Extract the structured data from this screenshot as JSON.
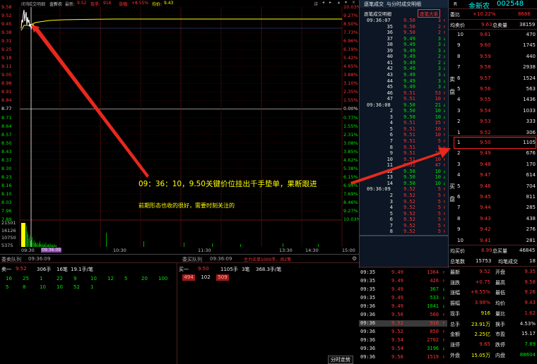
{
  "toolbar": {
    "items": [
      "闭市",
      "成交明细",
      "金新农",
      "最新:",
      "9.52",
      "现手:",
      "916",
      "涨幅:",
      "+8.55%",
      "均价:",
      "9.43"
    ],
    "more": "详"
  },
  "chart": {
    "price_labels": [
      "9.58",
      "9.52",
      "9.45",
      "9.38",
      "9.31",
      "9.25",
      "9.18",
      "9.11",
      "9.05",
      "8.98",
      "8.91",
      "8.84",
      "8.77",
      "8.71",
      "8.64",
      "8.57",
      "8.50",
      "8.43",
      "8.37",
      "8.30",
      "8.23",
      "8.16",
      "8.10",
      "8.03",
      "7.96",
      "7.89"
    ],
    "pct_labels": [
      "10.03%",
      "9.27%",
      "8.50%",
      "7.73%",
      "6.96%",
      "6.19%",
      "5.42%",
      "4.65%",
      "3.88%",
      "3.10%",
      "2.35%",
      "1.55%",
      "0.00%",
      "0.77%",
      "1.55%",
      "2.31%",
      "3.08%",
      "3.85%",
      "4.62%",
      "5.38%",
      "6.15%",
      "6.94%",
      "7.69%",
      "8.46%",
      "9.27%",
      "10.03%"
    ],
    "vol_labels": [
      "21501",
      "16126",
      "10750",
      "5375"
    ],
    "time_labels": [
      "09:30",
      "10:30",
      "11:30",
      "13:30",
      "14:30",
      "15:00"
    ],
    "cursor_time": "09:36:09",
    "annotation": {
      "line1": "09：36：10，9.50关键价位挂出千手垫单，果断跟进",
      "line2": "前期形态也收的很好，需要时刻关注的"
    }
  },
  "queue": {
    "left_title": "委卖队列",
    "left_time": "09:36:09",
    "right_title": "委买队列",
    "right_time": "09:36:09",
    "right_note": "主力买单1000手，共2笔",
    "sell1": {
      "label": "卖一",
      "price": "9.52",
      "hands": "306手",
      "count": "16笔",
      "avg": "19.1手/笔"
    },
    "sell_queue_row1": [
      "16",
      "25",
      "1",
      "22",
      "9",
      "10",
      "12",
      "5",
      "20",
      "100"
    ],
    "sell_queue_row2": [
      "5",
      "8",
      "10",
      "10",
      "52",
      "1"
    ],
    "buy1": {
      "label": "买一",
      "price": "9.50",
      "hands": "1105手",
      "count": "3笔",
      "avg": "368.3手/笔"
    },
    "buy_queue": [
      "494",
      "102",
      "509"
    ]
  },
  "ticker": {
    "tab1": "逐笔成交",
    "tab2": "与分时成交明细",
    "sub_title": "逐笔成交明细",
    "btn": "逐笔大单",
    "rows": [
      {
        "t": "09:36:07",
        "p": "9.50",
        "v": "3",
        "d": "buy"
      },
      {
        "t": "35",
        "p": "9.50",
        "v": "2",
        "d": "buy"
      },
      {
        "t": "36",
        "p": "9.50",
        "v": "2",
        "d": "buy"
      },
      {
        "t": "37",
        "p": "9.49",
        "v": "3",
        "d": "sell"
      },
      {
        "t": "38",
        "p": "9.49",
        "v": "3",
        "d": "sell"
      },
      {
        "t": "39",
        "p": "9.49",
        "v": "3",
        "d": "sell"
      },
      {
        "t": "40",
        "p": "9.49",
        "v": "2",
        "d": "sell"
      },
      {
        "t": "41",
        "p": "9.49",
        "v": "2",
        "d": "sell"
      },
      {
        "t": "42",
        "p": "9.49",
        "v": "3",
        "d": "sell"
      },
      {
        "t": "43",
        "p": "9.49",
        "v": "3",
        "d": "sell"
      },
      {
        "t": "44",
        "p": "9.49",
        "v": "3",
        "d": "sell"
      },
      {
        "t": "45",
        "p": "9.49",
        "v": "3",
        "d": "sell"
      },
      {
        "t": "46",
        "p": "9.51",
        "v": "53",
        "d": "buy"
      },
      {
        "t": "47",
        "p": "9.51",
        "v": "10",
        "d": "buy"
      },
      {
        "t": "09:36:08",
        "p": "9.50",
        "v": "21",
        "d": "sell"
      },
      {
        "t": "2",
        "p": "9.50",
        "v": "10",
        "d": "sell"
      },
      {
        "t": "3",
        "p": "9.50",
        "v": "10",
        "d": "sell"
      },
      {
        "t": "4",
        "p": "9.51",
        "v": "35",
        "d": "buy"
      },
      {
        "t": "5",
        "p": "9.51",
        "v": "10",
        "d": "buy"
      },
      {
        "t": "6",
        "p": "9.51",
        "v": "10",
        "d": "buy"
      },
      {
        "t": "7",
        "p": "9.51",
        "v": "5",
        "d": "buy"
      },
      {
        "t": "8",
        "p": "9.51",
        "v": "5",
        "d": "buy"
      },
      {
        "t": "9",
        "p": "9.51",
        "v": "10",
        "d": "buy"
      },
      {
        "t": "10",
        "p": "9.51",
        "v": "10",
        "d": "buy"
      },
      {
        "t": "11",
        "p": "9.51",
        "v": "47",
        "d": "buy"
      },
      {
        "t": "12",
        "p": "9.50",
        "v": "10",
        "d": "sell"
      },
      {
        "t": "13",
        "p": "9.50",
        "v": "10",
        "d": "sell"
      },
      {
        "t": "14",
        "p": "9.50",
        "v": "10",
        "d": "sell"
      },
      {
        "t": "09:36:09",
        "p": "9.52",
        "v": "5",
        "d": "buy"
      },
      {
        "t": "2",
        "p": "9.52",
        "v": "5",
        "d": "buy"
      },
      {
        "t": "3",
        "p": "9.52",
        "v": "5",
        "d": "buy"
      },
      {
        "t": "4",
        "p": "9.52",
        "v": "5",
        "d": "buy"
      },
      {
        "t": "5",
        "p": "9.52",
        "v": "5",
        "d": "buy"
      },
      {
        "t": "6",
        "p": "9.52",
        "v": "5",
        "d": "buy"
      },
      {
        "t": "7",
        "p": "9.52",
        "v": "5",
        "d": "buy"
      },
      {
        "t": "8",
        "p": "9.52",
        "v": "5",
        "d": "buy"
      }
    ],
    "minute_rows": [
      {
        "t": "09:35",
        "p": "9.49",
        "v": "1364",
        "d": "buy"
      },
      {
        "t": "09:35",
        "p": "9.49",
        "v": "426",
        "d": "buy"
      },
      {
        "t": "09:35",
        "p": "9.49",
        "v": "367",
        "d": "sell"
      },
      {
        "t": "09:35",
        "p": "9.49",
        "v": "533",
        "d": "sell"
      },
      {
        "t": "09:36",
        "p": "9.49",
        "v": "1041",
        "d": "sell"
      },
      {
        "t": "09:36",
        "p": "9.50",
        "v": "560",
        "d": "buy"
      },
      {
        "t": "09:36",
        "p": "9.52",
        "v": "916",
        "d": "buy"
      },
      {
        "t": "09:36",
        "p": "9.52",
        "v": "850",
        "d": "buy"
      },
      {
        "t": "09:36",
        "p": "9.54",
        "v": "2702",
        "d": "buy"
      },
      {
        "t": "09:36",
        "p": "9.54",
        "v": "3196",
        "d": "sell"
      },
      {
        "t": "09:36",
        "p": "9.58",
        "v": "1519",
        "d": "buy"
      }
    ],
    "minute_tab": "分时走势"
  },
  "quote": {
    "r": "R",
    "name": "金新农",
    "code": "002548",
    "weibi_label": "委比",
    "weibi": "+10.22%",
    "weicha": "8686",
    "avg_sell_label": "均卖价",
    "avg_sell": "9.63",
    "total_sell_label": "总卖量",
    "total_sell": "38159",
    "sell_side_label": "卖盘",
    "sells": [
      [
        "10",
        "9.61",
        "470"
      ],
      [
        "9",
        "9.60",
        "1745"
      ],
      [
        "8",
        "9.59",
        "440"
      ],
      [
        "7",
        "9.58",
        "2938"
      ],
      [
        "6",
        "9.57",
        "1524"
      ],
      [
        "5",
        "9.56",
        "563"
      ],
      [
        "4",
        "9.55",
        "1436"
      ],
      [
        "3",
        "9.54",
        "1033"
      ],
      [
        "2",
        "9.53",
        "333"
      ],
      [
        "1",
        "9.52",
        "306"
      ]
    ],
    "buy_side_label": "买盘",
    "buys": [
      [
        "1",
        "9.50",
        "1105"
      ],
      [
        "2",
        "9.49",
        "676"
      ],
      [
        "3",
        "9.48",
        "170"
      ],
      [
        "4",
        "9.47",
        "614"
      ],
      [
        "5",
        "9.46",
        "704"
      ],
      [
        "6",
        "9.45",
        "811"
      ],
      [
        "7",
        "9.44",
        "285"
      ],
      [
        "8",
        "9.43",
        "438"
      ],
      [
        "9",
        "9.42",
        "276"
      ],
      [
        "10",
        "9.41",
        "281"
      ]
    ],
    "avg_buy_label": "均买价",
    "avg_buy": "8.99",
    "total_buy_label": "总买量",
    "total_buy": "46845",
    "total_count_label": "总笔数",
    "total_count": "15753",
    "per_label": "均笔成交",
    "per": "18",
    "stats": [
      [
        "最新",
        "9.52",
        "开盘",
        "9.35"
      ],
      [
        "涨跌",
        "+0.75",
        "最高",
        "9.58"
      ],
      [
        "涨幅",
        "+8.55%",
        "最低",
        "9.26"
      ],
      [
        "振幅",
        "3.98%",
        "均价",
        "9.43"
      ],
      [
        "现手",
        "916",
        "量比",
        "1.62"
      ],
      [
        "总手",
        "23.91万",
        "换手",
        "4.53%"
      ],
      [
        "金额",
        "2.25亿",
        "市盈",
        "15.17"
      ],
      [
        "涨停",
        "9.65",
        "跌停",
        "7.89"
      ],
      [
        "外盘",
        "15.05万",
        "内盘",
        "88604"
      ]
    ]
  },
  "colors": {
    "up": "#ff3333",
    "down": "#00e600",
    "price_line": "#ffffff",
    "avg_line": "#ffff00",
    "arrow": "#e8281e"
  }
}
